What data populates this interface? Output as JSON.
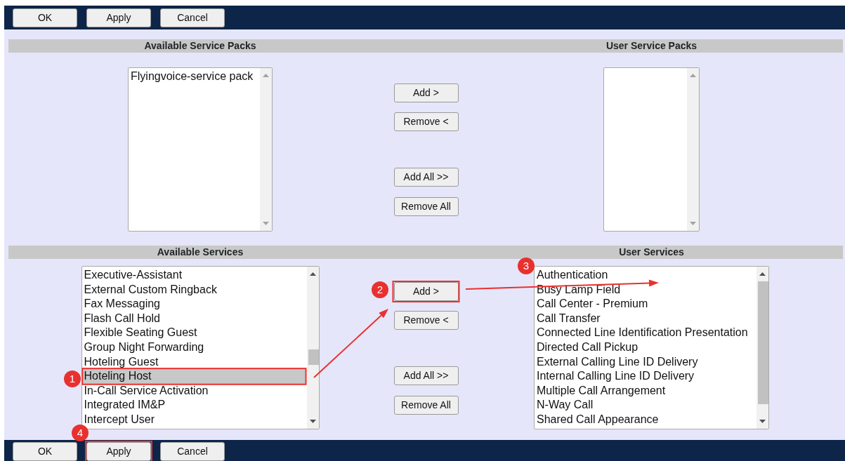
{
  "top_buttons": [
    "OK",
    "Apply",
    "Cancel"
  ],
  "service_packs": {
    "available_title": "Available Service Packs",
    "user_title": "User Service Packs",
    "available": [
      {
        "label": "Flyingvoice-service pack",
        "selected": false
      }
    ],
    "buttons": [
      "Add >",
      "Remove <",
      "Add All >>",
      "Remove All"
    ]
  },
  "services": {
    "available_title": "Available Services",
    "user_title": "User Services",
    "available": [
      {
        "label": "Executive-Assistant",
        "selected": false
      },
      {
        "label": "External Custom Ringback",
        "selected": false
      },
      {
        "label": "Fax Messaging",
        "selected": false
      },
      {
        "label": "Flash Call Hold",
        "selected": false
      },
      {
        "label": "Flexible Seating Guest",
        "selected": false
      },
      {
        "label": "Group Night Forwarding",
        "selected": false
      },
      {
        "label": "Hoteling Guest",
        "selected": false
      },
      {
        "label": "Hoteling Host",
        "selected": true
      },
      {
        "label": "In-Call Service Activation",
        "selected": false
      },
      {
        "label": "Integrated IM&P",
        "selected": false
      },
      {
        "label": "Intercept User",
        "selected": false
      }
    ],
    "user": [
      {
        "label": "Authentication",
        "selected": false
      },
      {
        "label": "Busy Lamp Field",
        "selected": false
      },
      {
        "label": "Call Center - Premium",
        "selected": false
      },
      {
        "label": "Call Transfer",
        "selected": false
      },
      {
        "label": "Connected Line Identification Presentation",
        "selected": false
      },
      {
        "label": "Directed Call Pickup",
        "selected": false
      },
      {
        "label": "External Calling Line ID Delivery",
        "selected": false
      },
      {
        "label": "Internal Calling Line ID Delivery",
        "selected": false
      },
      {
        "label": "Multiple Call Arrangement",
        "selected": false
      },
      {
        "label": "N-Way Call",
        "selected": false
      },
      {
        "label": "Shared Call Appearance",
        "selected": false
      }
    ],
    "buttons": [
      "Add >",
      "Remove <",
      "Add All >>",
      "Remove All"
    ]
  },
  "bottom_buttons": [
    "OK",
    "Apply",
    "Cancel"
  ],
  "callouts": [
    {
      "label": "1",
      "kind": "boxed"
    },
    {
      "label": "2",
      "kind": "boxed"
    },
    {
      "label": "3",
      "kind": "plain"
    },
    {
      "label": "4",
      "kind": "boxed"
    }
  ]
}
